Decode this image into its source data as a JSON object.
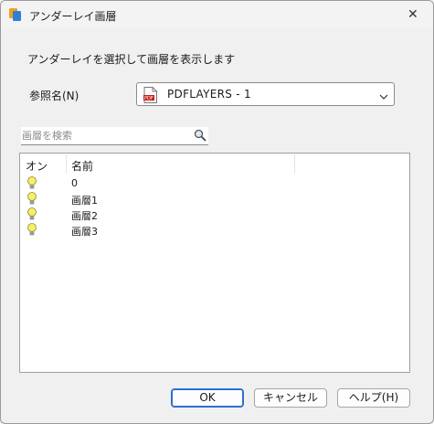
{
  "window": {
    "title": "アンダーレイ画層",
    "close_glyph": "✕",
    "app_icon": "autocad-layers-icon"
  },
  "description": "アンダーレイを選択して画層を表示します",
  "reference": {
    "label": "参照名(N)",
    "selected": "PDFLAYERS - 1",
    "file_icon": "pdf-icon"
  },
  "search": {
    "placeholder": "画層を検索",
    "value": ""
  },
  "list": {
    "headers": {
      "on": "オン",
      "name": "名前"
    },
    "rows": [
      {
        "on": true,
        "name": "0"
      },
      {
        "on": true,
        "name": "画層1"
      },
      {
        "on": true,
        "name": "画層2"
      },
      {
        "on": true,
        "name": "画層3"
      }
    ]
  },
  "buttons": {
    "ok": "OK",
    "cancel": "キャンセル",
    "help": "ヘルプ(H)"
  },
  "colors": {
    "accent": "#2a6fd1",
    "bulb": "#f5ee6a",
    "pdf_red": "#c8201d"
  }
}
